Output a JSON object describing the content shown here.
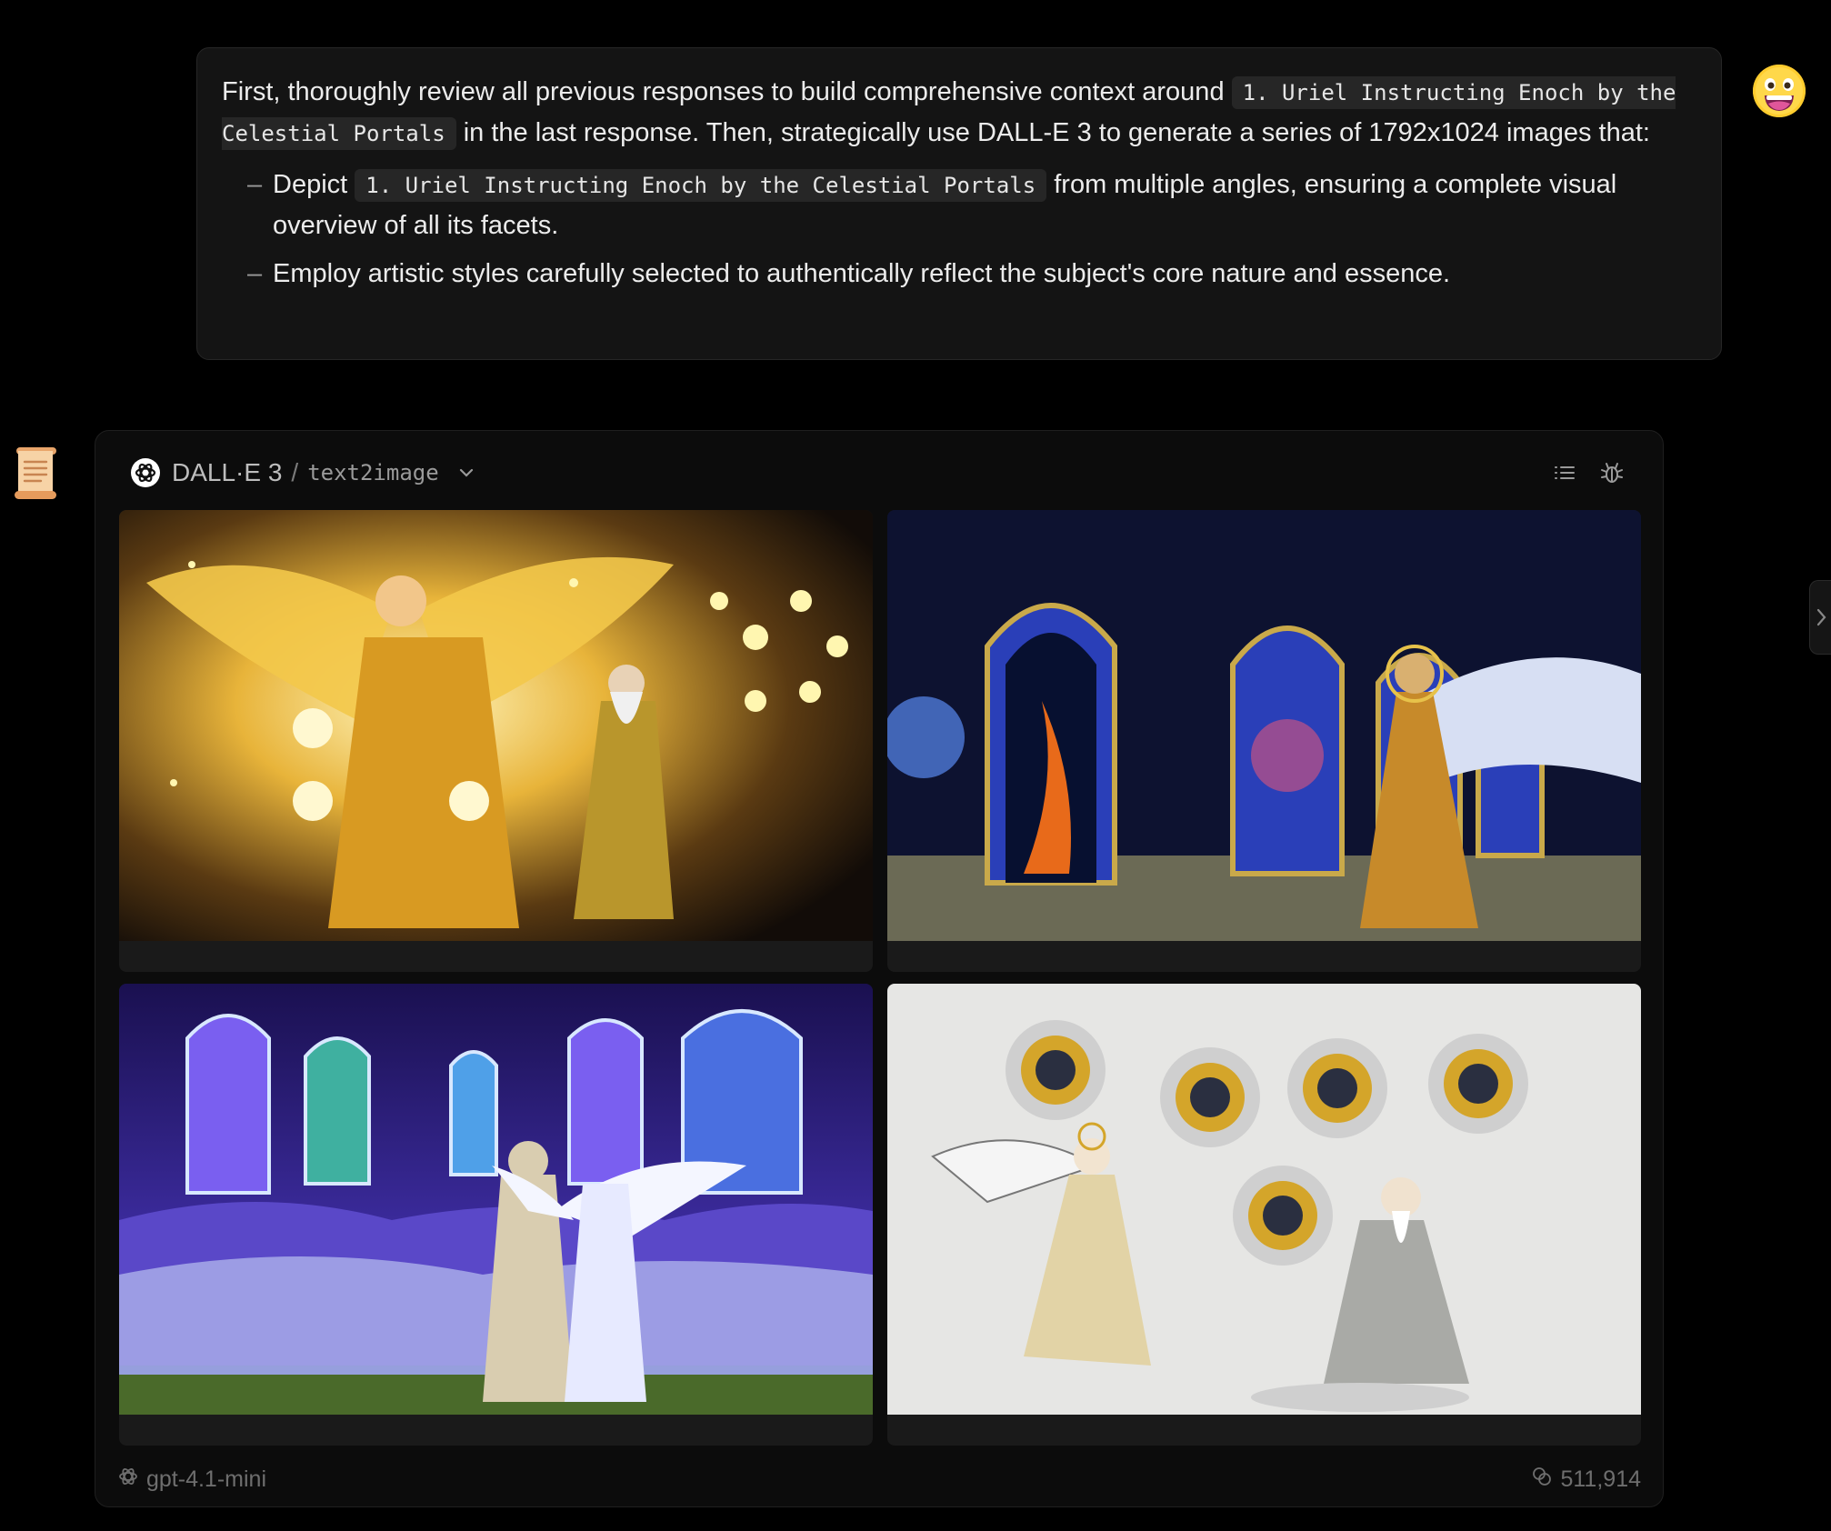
{
  "user_message": {
    "intro_part1": "First, thoroughly review all previous responses to build comprehensive context around ",
    "intro_code": "1. Uriel Instructing Enoch by the Celestial Portals",
    "intro_part2": " in the last response. Then, strategically use DALL-E 3 to generate a series of 1792x1024 images that:",
    "bullets": [
      {
        "marker": "–",
        "part1": "Depict ",
        "code": "1. Uriel Instructing Enoch by the Celestial Portals",
        "part2": " from multiple angles, ensuring a complete visual overview of all its facets."
      },
      {
        "marker": "–",
        "text": "Employ artistic styles carefully selected to authentically reflect the subject's core nature and essence."
      }
    ],
    "avatar_icon": "grinning-face-emoji-icon"
  },
  "assistant": {
    "avatar_icon": "scroll-icon",
    "tool": {
      "provider_icon": "openai-logo-icon",
      "model": "DALL·E 3",
      "separator": "/",
      "mode": "text2image",
      "dropdown_icon": "chevron-down-icon"
    },
    "header_actions": [
      "list-icon",
      "bug-icon"
    ],
    "images": [
      {
        "subject": "golden archangel with wings and robed elder among star constellations"
      },
      {
        "subject": "ornate golden arched portals to galaxies with robed elder and winged figure"
      },
      {
        "subject": "glowing portals above purple clouds with two robed figures, one winged"
      },
      {
        "subject": "ink-wash painting of angel and seated sage beneath gold celestial circles"
      }
    ],
    "footer": {
      "model_icon": "openai-logo-icon",
      "model": "gpt-4.1-mini",
      "token_icon": "token-coins-icon",
      "tokens": "511,914"
    }
  },
  "colors": {
    "background": "#000000",
    "bubble": "#141414",
    "card": "#0c0c0c",
    "code_bg": "#262626",
    "text": "#ececec",
    "muted": "#6e6e6e"
  }
}
